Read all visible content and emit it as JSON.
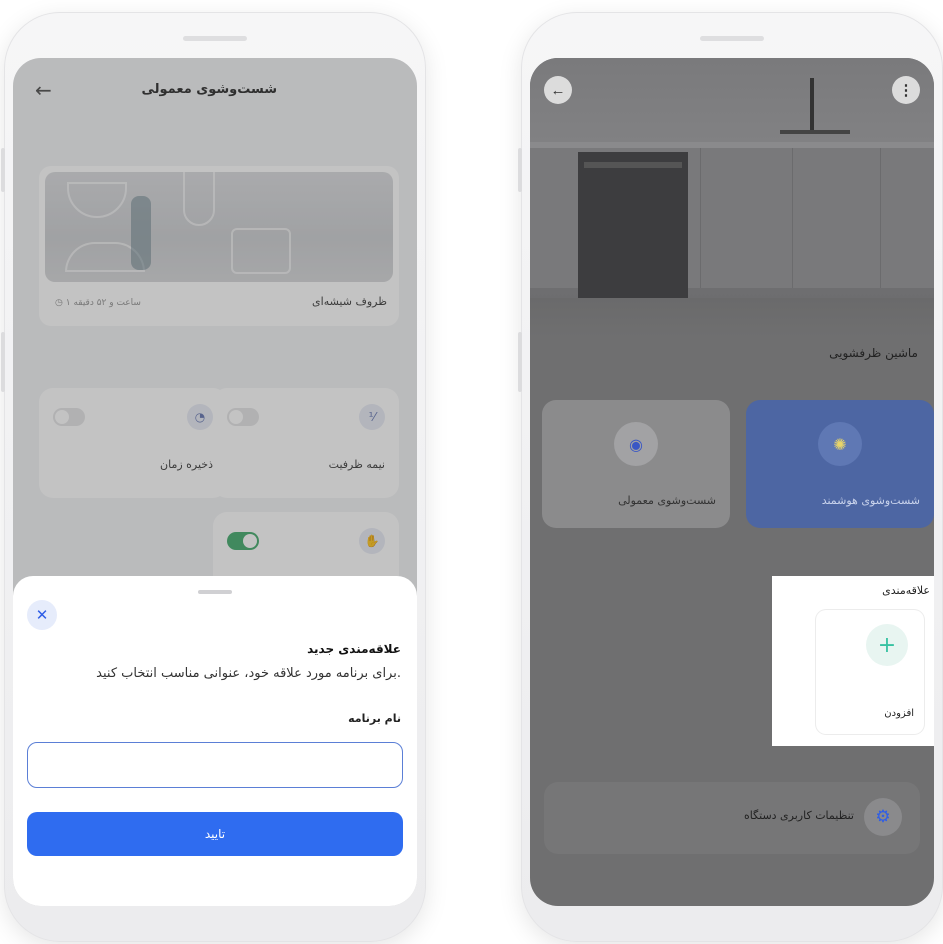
{
  "left_screen": {
    "header": {
      "title": "شست‌وشوی معمولی",
      "back_icon": "arrow-left-icon"
    },
    "program_card": {
      "name": "ظروف شیشه‌ای",
      "duration": "۱ ساعت و ۵۲ دقیقه",
      "clock_icon": "clock-icon"
    },
    "options": [
      {
        "label": "نیمه ظرفیت",
        "icon": "half-load-icon",
        "enabled": false
      },
      {
        "label": "ذخیره زمان",
        "icon": "timer-icon",
        "enabled": false
      },
      {
        "label": "",
        "icon": "hand-icon",
        "enabled": true
      }
    ],
    "sheet": {
      "title": "علاقه‌مندی جدید",
      "description": "برای برنامه مورد علاقه خود، عنوانی مناسب انتخاب کنید.",
      "field_label": "نام برنامه",
      "field_value": "",
      "field_placeholder": "",
      "confirm_label": "تایید",
      "close_icon": "close-icon"
    }
  },
  "right_screen": {
    "header": {
      "back_icon": "arrow-left-icon",
      "menu_icon": "kebab-menu-icon"
    },
    "section_title": "ماشین ظرفشویی",
    "modes": [
      {
        "label": "شست‌وشوی هوشمند",
        "icon": "smart-bulb-icon",
        "selected": true
      },
      {
        "label": "شست‌وشوی معمولی",
        "icon": "wash-icon",
        "selected": false
      }
    ],
    "favorites": {
      "title": "علاقه‌مندی",
      "add_label": "افزودن",
      "add_icon": "plus-icon"
    },
    "settings": {
      "label": "تنظیمات کاربری دستگاه",
      "icon": "gear-icon"
    }
  },
  "colors": {
    "primary": "#2f6cf0",
    "smart_mode": "#4d66a3",
    "toggle_on": "#4caf73",
    "add_accent": "#37c2a2"
  }
}
